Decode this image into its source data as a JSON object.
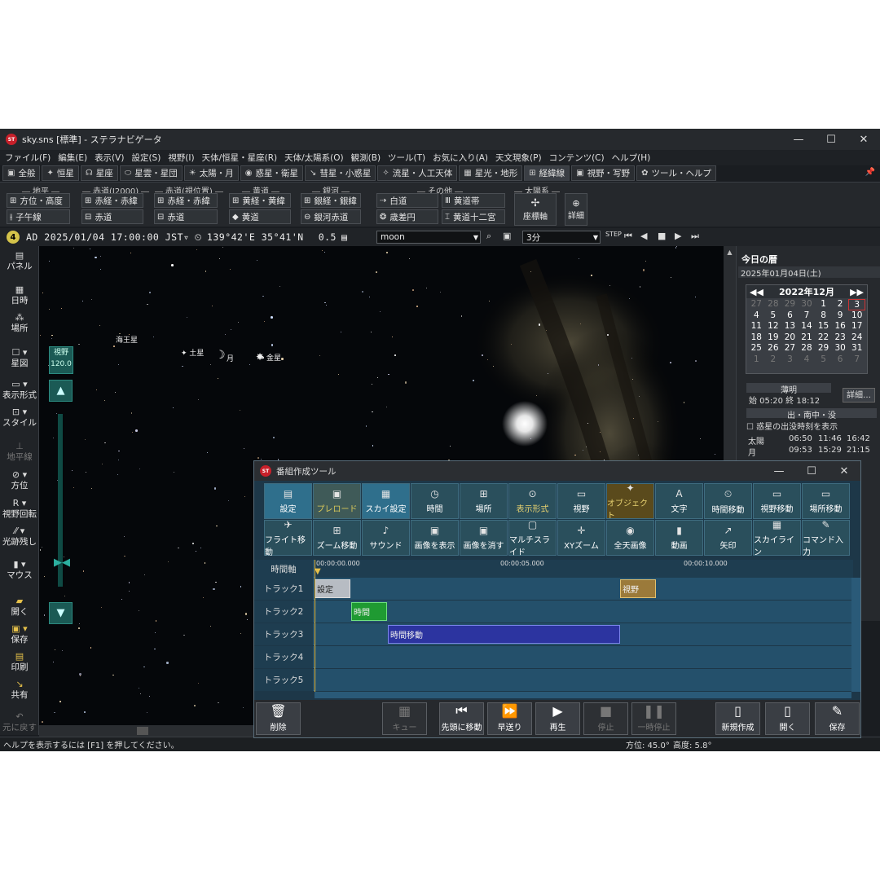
{
  "window": {
    "title": "sky.sns [標準] - ステラナビゲータ",
    "icon": "app-logo"
  },
  "menu": [
    "ファイル(F)",
    "編集(E)",
    "表示(V)",
    "設定(S)",
    "視野(I)",
    "天体/恒星・星座(R)",
    "天体/太陽系(O)",
    "観測(B)",
    "ツール(T)",
    "お気に入り(A)",
    "天文現象(P)",
    "コンテンツ(C)",
    "ヘルプ(H)"
  ],
  "tabs": [
    {
      "icon": "▣",
      "label": "全般"
    },
    {
      "icon": "✦",
      "label": "恒星"
    },
    {
      "icon": "☊",
      "label": "星座"
    },
    {
      "icon": "⬭",
      "label": "星雲・星団"
    },
    {
      "icon": "☀",
      "label": "太陽・月"
    },
    {
      "icon": "◉",
      "label": "惑星・衛星"
    },
    {
      "icon": "↘",
      "label": "彗星・小惑星"
    },
    {
      "icon": "✧",
      "label": "流星・人工天体"
    },
    {
      "icon": "▦",
      "label": "星光・地形"
    },
    {
      "icon": "⊞",
      "label": "経緯線"
    },
    {
      "icon": "▣",
      "label": "視野・写野"
    },
    {
      "icon": "✿",
      "label": "ツール・ヘルプ"
    }
  ],
  "ribbon": {
    "groups": [
      "地平",
      "赤道(J2000)",
      "赤道(視位置)",
      "黄道",
      "銀河",
      "その他",
      "太陽系"
    ],
    "buttons": {
      "azalt": "方位・高度",
      "meridian": "子午線",
      "ra_j2000": "赤経・赤緯",
      "eq_j2000": "赤道",
      "ra_app": "赤経・赤緯",
      "eq_app": "赤道",
      "ecl_lonlat": "黄経・黄緯",
      "ecliptic": "黄道",
      "gal_lonlat": "銀経・銀緯",
      "gal_eq": "銀河赤道",
      "white_way": "白道",
      "zodiac_band": "黄道帯",
      "aberration": "歳差円",
      "zodiac12": "黄道十二宮",
      "coord_axis": "座標軸",
      "detail": "詳細"
    }
  },
  "timebar": {
    "badge": "4",
    "datetime": "AD 2025/01/04 17:00:00 JST▿",
    "location": "139°42'E 35°41'N",
    "magnitude": "0.5",
    "search": "moon",
    "step": "3分"
  },
  "left_toolbar": [
    "パネル",
    "日時",
    "場所",
    "星図",
    "表示形式",
    "スタイル",
    "地平線",
    "方位",
    "視野回転",
    "光跡残し",
    "マウス",
    "開く",
    "保存",
    "印刷",
    "共有",
    "元に戻す"
  ],
  "sky": {
    "labels": {
      "neptune": "海王星",
      "saturn": "土星",
      "moon": "月",
      "venus": "金星"
    },
    "fov_label": "視野",
    "fov_value": "120.0"
  },
  "right_panel": {
    "title": "今日の暦",
    "date": "2025年01月04日(土)",
    "cal_title": "2022年12月",
    "cal_days": [
      "27",
      "28",
      "29",
      "30",
      "1",
      "2",
      "3",
      "4",
      "5",
      "6",
      "7",
      "8",
      "9",
      "10",
      "11",
      "12",
      "13",
      "14",
      "15",
      "16",
      "17",
      "18",
      "19",
      "20",
      "21",
      "22",
      "23",
      "24",
      "25",
      "26",
      "27",
      "28",
      "29",
      "30",
      "31",
      "1",
      "2",
      "3",
      "4",
      "5",
      "6",
      "7"
    ],
    "twilight_title": "薄明",
    "twilight": "始 05:20  終 18:12",
    "detail_btn": "詳細…",
    "rise_set_title": "出・南中・没",
    "show_planets": "惑星の出没時刻を表示",
    "sun_label": "太陽",
    "sun_times": [
      "06:50",
      "11:46",
      "16:42"
    ],
    "moon_label": "月",
    "moon_times": [
      "09:53",
      "15:29",
      "21:15"
    ]
  },
  "dialog": {
    "title": "番組作成ツール",
    "palette_row1": [
      "設定",
      "プレロード",
      "スカイ設定",
      "時間",
      "場所",
      "表示形式",
      "視野",
      "オブジェクト",
      "文字",
      "時間移動",
      "視野移動",
      "場所移動"
    ],
    "palette_row2": [
      "フライト移動",
      "ズーム移動",
      "サウンド",
      "画像を表示",
      "画像を消す",
      "マルチスライド",
      "XYズーム",
      "全天画像",
      "動画",
      "矢印",
      "スカイライン",
      "コマンド入力"
    ],
    "timeline_label": "時間軸",
    "ticks": [
      "00:00:00.000",
      "00:00:05.000",
      "00:00:10.000"
    ],
    "tracks": [
      "トラック1",
      "トラック2",
      "トラック3",
      "トラック4",
      "トラック5"
    ],
    "blocks": {
      "settings": "設定",
      "fov": "視野",
      "time": "時間",
      "time_move": "時間移動"
    },
    "bottom": {
      "delete": "削除",
      "cue": "キュー",
      "to_start": "先頭に移動",
      "fast_forward": "早送り",
      "play": "再生",
      "stop": "停止",
      "pause": "一時停止",
      "new": "新規作成",
      "open": "開く",
      "save": "保存"
    }
  },
  "status": {
    "help": "ヘルプを表示するには [F1] を押してください。",
    "azimuth": "方位: 45.0°",
    "altitude": "高度: 5.8°"
  }
}
